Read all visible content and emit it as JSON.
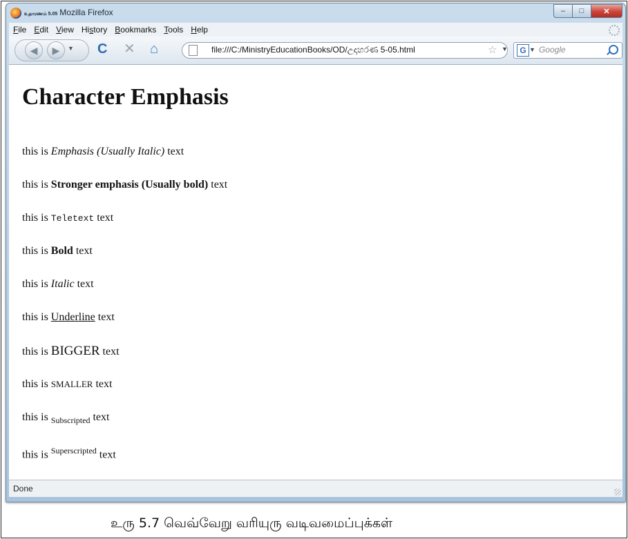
{
  "window": {
    "title_tab": "உதாரணம் 5.05",
    "title": "Mozilla Firefox",
    "controls": {
      "minimize": "–",
      "maximize": "□",
      "close": "✕"
    }
  },
  "menu": [
    "File",
    "Edit",
    "View",
    "History",
    "Bookmarks",
    "Tools",
    "Help"
  ],
  "toolbar": {
    "url": "file:///C:/MinistryEducationBooks/OD/උදාහරණ 5-05.html",
    "search_placeholder": "Google",
    "search_engine": "G"
  },
  "page": {
    "heading": "Character Emphasis",
    "lines": [
      {
        "prefix": "this is ",
        "styled": "Emphasis (Usually Italic)",
        "suffix": " text"
      },
      {
        "prefix": "this is ",
        "styled": "Stronger emphasis (Usually bold)",
        "suffix": " text"
      },
      {
        "prefix": "this is ",
        "styled": "Teletext",
        "suffix": " text"
      },
      {
        "prefix": "this is ",
        "styled": "Bold",
        "suffix": " text"
      },
      {
        "prefix": "this is ",
        "styled": "Italic",
        "suffix": " text"
      },
      {
        "prefix": "this is ",
        "styled": "Underline",
        "suffix": " text"
      },
      {
        "prefix": "this is ",
        "styled": "BIGGER",
        "suffix": " text"
      },
      {
        "prefix": "this is ",
        "styled": "SMALLER",
        "suffix": " text"
      },
      {
        "prefix": "this is ",
        "styled": "Subscripted",
        "suffix": " text"
      },
      {
        "prefix": "this is ",
        "styled": "Superscripted",
        "suffix": " text"
      }
    ]
  },
  "status": "Done",
  "caption": "உரு 5.7 வெவ்வேறு வரியுரு வடிவமைப்புக்கள்"
}
